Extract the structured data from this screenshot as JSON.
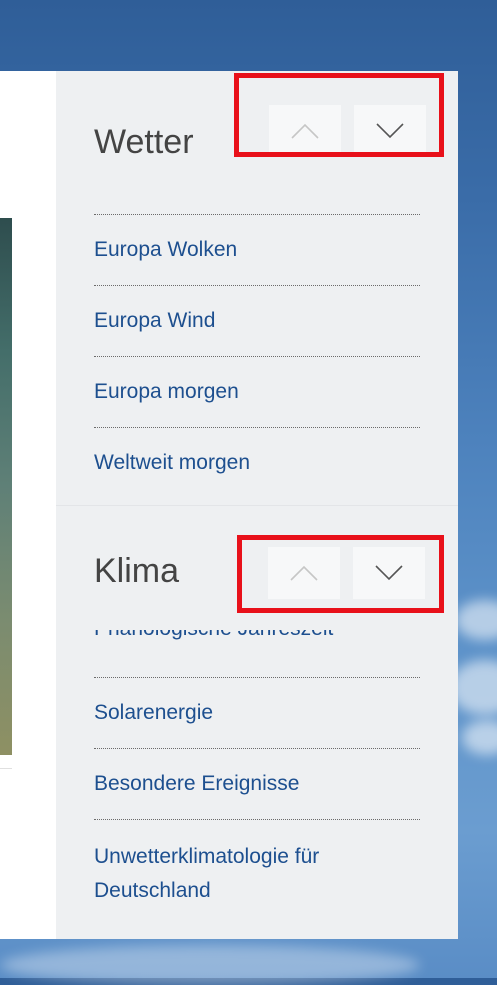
{
  "wetter": {
    "title": "Wetter",
    "links": [
      "Europa Wolken",
      "Europa Wind",
      "Europa morgen",
      "Weltweit morgen"
    ]
  },
  "klima": {
    "title": "Klima",
    "partial_link": "Phänologische Jahreszeit",
    "links": [
      "Solarenergie",
      "Besondere Ereignisse",
      "Unwetterklimatologie für Deutschland"
    ]
  },
  "colors": {
    "link": "#1d4f8f",
    "highlight": "#e8101a",
    "panel": "#eef0f2"
  },
  "icons": [
    "chevron-up-icon",
    "chevron-down-icon"
  ]
}
